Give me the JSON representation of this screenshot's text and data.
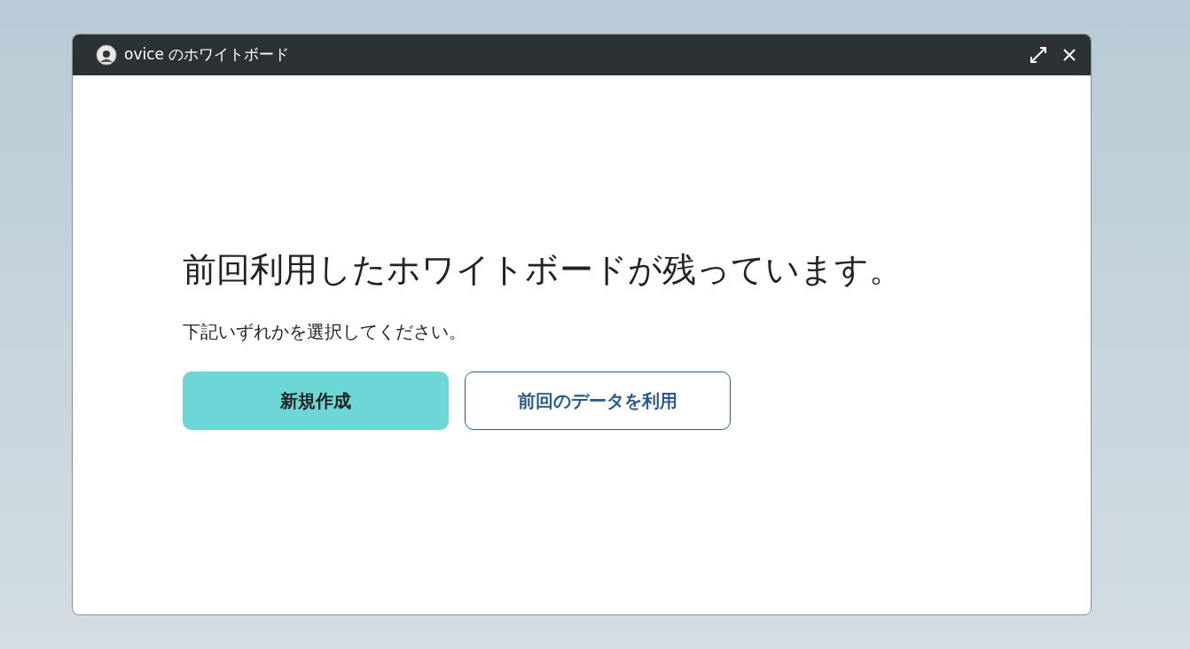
{
  "window": {
    "title": "ovice のホワイトボード"
  },
  "heading": "前回利用したホワイトボードが残っています。",
  "instruction": "下記いずれかを選択してください。",
  "buttons": [
    {
      "label": "新規作成",
      "kind": "primary"
    },
    {
      "label": "前回のデータを利用",
      "kind": "outline"
    }
  ]
}
